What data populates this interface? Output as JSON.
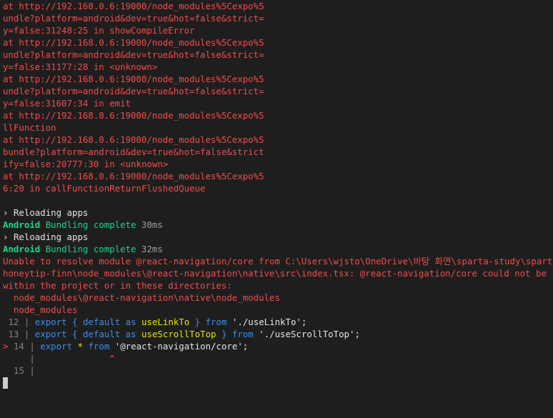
{
  "stack_trace": [
    "at http://192.168.0.6:19000/node_modules%5Cexpo%5",
    "undle?platform=android&dev=true&hot=false&strict=",
    "y=false:31248:25 in showCompileError",
    "at http://192.168.0.6:19000/node_modules%5Cexpo%5",
    "undle?platform=android&dev=true&hot=false&strict=",
    "y=false:31177:28 in <unknown>",
    "at http://192.168.0.6:19000/node_modules%5Cexpo%5",
    "undle?platform=android&dev=true&hot=false&strict=",
    "y=false:31607:34 in emit",
    "at http://192.168.0.6:19000/node_modules%5Cexpo%5",
    "llFunction",
    "at http://192.168.0.6:19000/node_modules%5Cexpo%5",
    "bundle?platform=android&dev=true&hot=false&strict",
    "ify=false:20777:30 in <unknown>",
    "at http://192.168.0.6:19000/node_modules%5Cexpo%5",
    "6:20 in callFunctionReturnFlushedQueue"
  ],
  "reload_1": {
    "prompt": "›",
    "text": "Reloading apps"
  },
  "bundle_1": {
    "platform": "Android",
    "status": "Bundling complete",
    "time": "30ms"
  },
  "reload_2": {
    "prompt": "›",
    "text": "Reloading apps"
  },
  "bundle_2": {
    "platform": "Android",
    "status": "Bundling complete",
    "time": "32ms"
  },
  "error_message": [
    "Unable to resolve module @react-navigation/core from C:\\Users\\wjsto\\OneDrive\\바탕 화면\\sparta-study\\sparta-my",
    "honeytip-finn\\node_modules\\@react-navigation\\native\\src\\index.tsx: @react-navigation/core could not be found",
    "within the project or in these directories:"
  ],
  "directories": [
    "  node_modules\\@react-navigation\\native\\node_modules",
    "  node_modules"
  ],
  "code_frame": {
    "lines": [
      {
        "marker": " ",
        "num": "12",
        "kw1": "export",
        "brace_open": "{",
        "kw2": "default",
        "kw3": "as",
        "ident": "useLinkTo",
        "brace_close": "}",
        "kw4": "from",
        "str": "'./useLinkTo'",
        "end": ";"
      },
      {
        "marker": " ",
        "num": "13",
        "kw1": "export",
        "brace_open": "{",
        "kw2": "default",
        "kw3": "as",
        "ident": "useScrollToTop",
        "brace_close": "}",
        "kw4": "from",
        "str": "'./useScrollToTop'",
        "end": ";"
      }
    ],
    "error_line": {
      "marker": ">",
      "num": "14",
      "kw1": "export",
      "star": "*",
      "kw2": "from",
      "str": "'@react-navigation/core'",
      "end": ";"
    },
    "caret": "^",
    "empty_line_num": "15",
    "separator": "|"
  },
  "colors": {
    "background": "#1e1e1e",
    "error": "#f14c4c",
    "success": "#23d18b",
    "keyword": "#3b8eea",
    "identifier": "#e5e510"
  }
}
